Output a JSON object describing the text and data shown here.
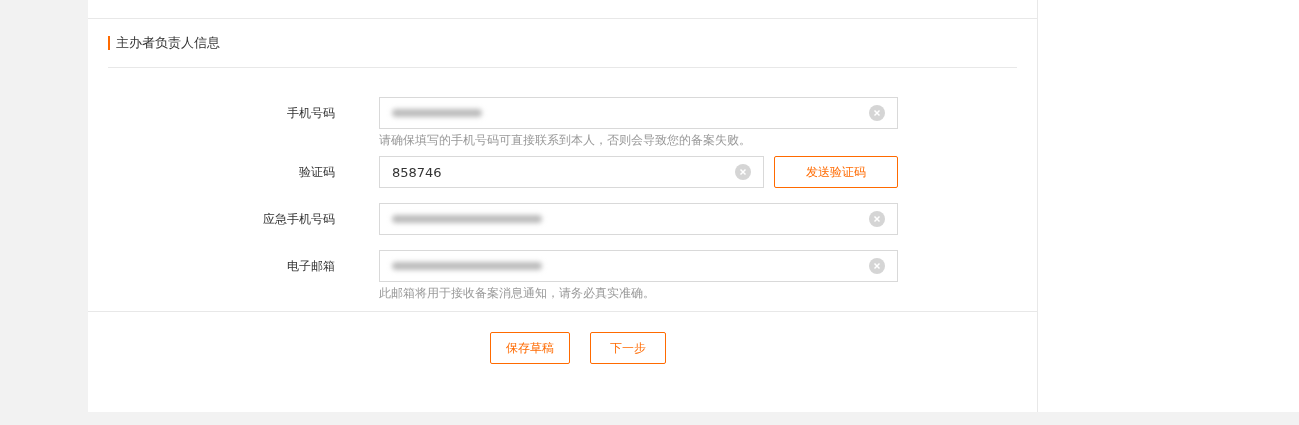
{
  "section": {
    "title": "主办者负责人信息"
  },
  "fields": [
    {
      "label": "手机号码",
      "blurred": true,
      "hint": "请确保填写的手机号码可直接联系到本人，否则会导致您的备案失败。"
    },
    {
      "label": "验证码",
      "blurred": false,
      "value": "858746",
      "button": "发送验证码"
    },
    {
      "label": "应急手机号码",
      "blurred": true
    },
    {
      "label": "电子邮箱",
      "blurred": true,
      "hint": "此邮箱将用于接收备案消息通知，请务必真实准确。"
    }
  ],
  "buttons": [
    "保存草稿",
    "下一步"
  ]
}
